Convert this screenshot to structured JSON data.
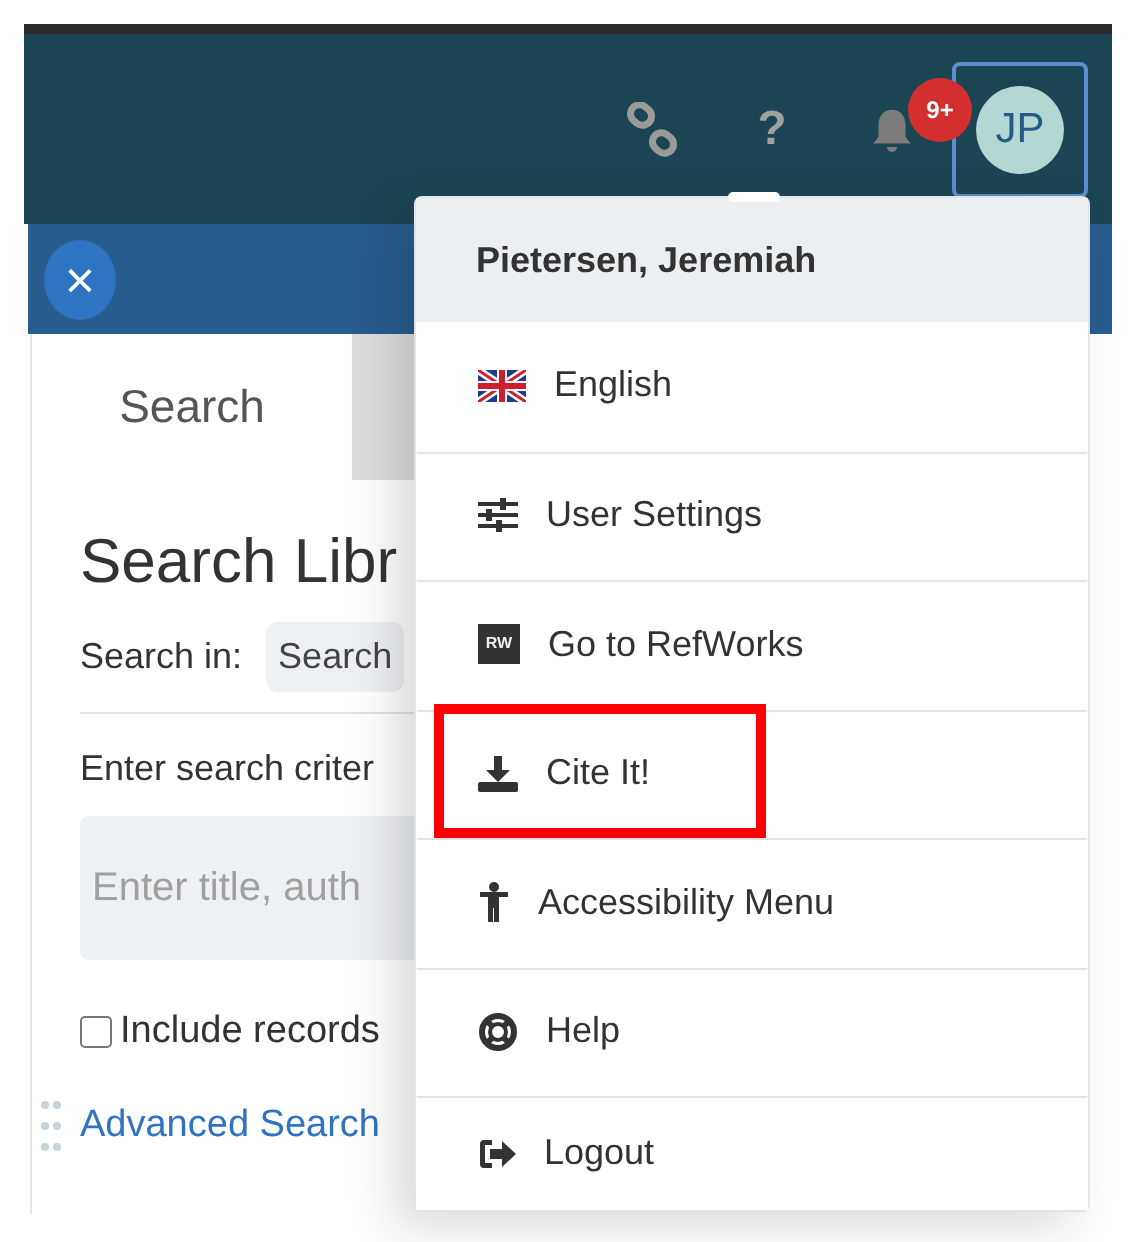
{
  "header": {
    "help_glyph": "?",
    "notifications_badge": "9+",
    "avatar_initials": "JP",
    "avatar_focused": true
  },
  "panel": {
    "close_glyph": "×",
    "tabs": [
      {
        "label": "Search",
        "selected": true
      },
      {
        "selected": false
      }
    ],
    "title": "Search Libr",
    "search_in_label": "Search in:",
    "search_in_value": "Search",
    "criteria_label": "Enter search criter",
    "query_placeholder": "Enter title, auth",
    "include_records": {
      "label": "Include records",
      "checked": false
    },
    "advanced_link": "Advanced Search"
  },
  "user_menu": {
    "user_name": "Pietersen, Jeremiah",
    "items": [
      {
        "kind": "flag",
        "label": "English",
        "highlighted": false
      },
      {
        "kind": "settings",
        "label": "User Settings",
        "highlighted": false
      },
      {
        "kind": "refworks",
        "label": "Go to RefWorks",
        "logo_text": "RW",
        "highlighted": false
      },
      {
        "kind": "download",
        "label": "Cite It!",
        "highlighted": true
      },
      {
        "kind": "accessibility",
        "label": "Accessibility Menu",
        "highlighted": false
      },
      {
        "kind": "help",
        "label": "Help",
        "highlighted": false
      },
      {
        "kind": "logout",
        "label": "Logout",
        "highlighted": false
      }
    ]
  }
}
